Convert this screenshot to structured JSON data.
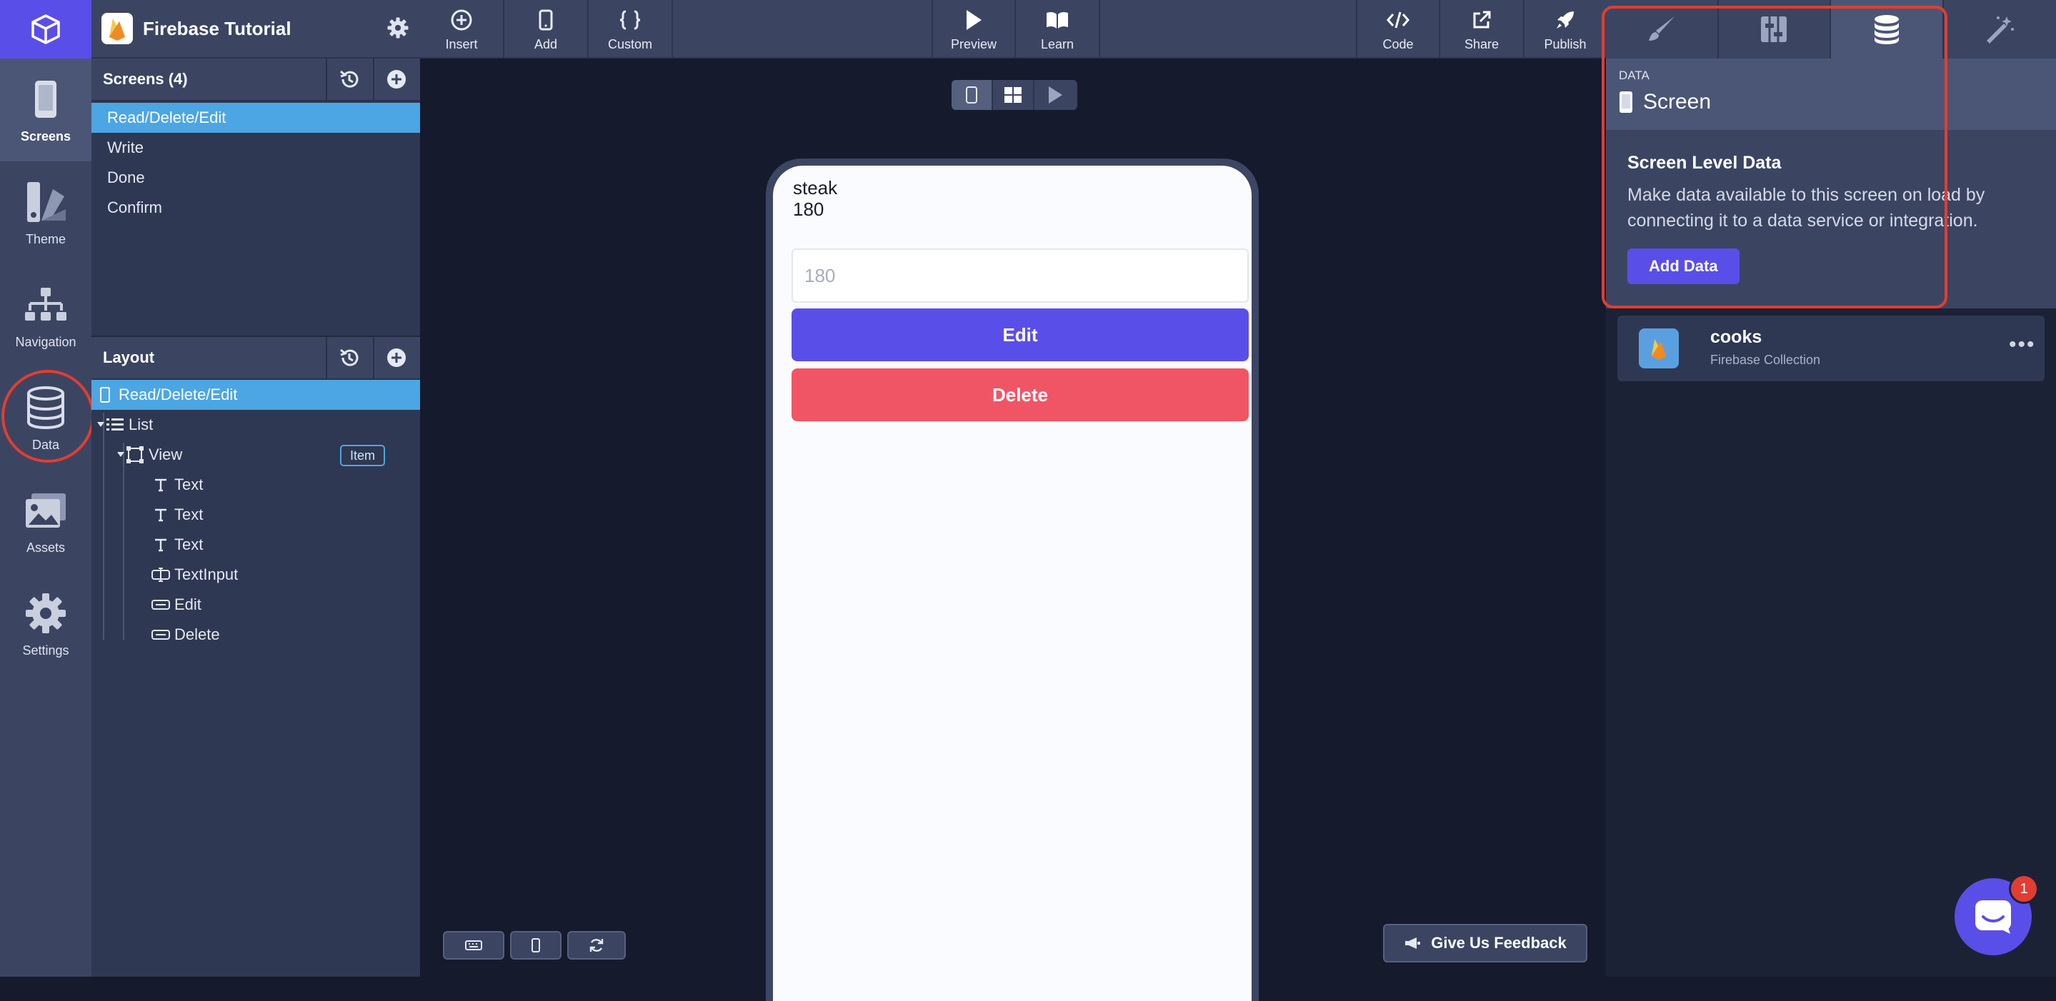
{
  "project": {
    "title": "Firebase Tutorial"
  },
  "rail": {
    "items": [
      {
        "label": "Screens",
        "icon": "phone-icon"
      },
      {
        "label": "Theme",
        "icon": "theme-icon"
      },
      {
        "label": "Navigation",
        "icon": "navigation-icon"
      },
      {
        "label": "Data",
        "icon": "database-icon"
      },
      {
        "label": "Assets",
        "icon": "image-icon"
      },
      {
        "label": "Settings",
        "icon": "gear-icon"
      }
    ]
  },
  "toolbar": {
    "insert": "Insert",
    "add": "Add",
    "custom": "Custom",
    "preview": "Preview",
    "learn": "Learn",
    "code": "Code",
    "share": "Share",
    "publish": "Publish"
  },
  "screens": {
    "title": "Screens (4)",
    "items": [
      "Read/Delete/Edit",
      "Write",
      "Done",
      "Confirm"
    ]
  },
  "layout": {
    "title": "Layout",
    "tree": [
      {
        "label": "Read/Delete/Edit"
      },
      {
        "label": "List"
      },
      {
        "label": "View",
        "badge": "Item"
      },
      {
        "label": "Text"
      },
      {
        "label": "Text"
      },
      {
        "label": "Text"
      },
      {
        "label": "TextInput"
      },
      {
        "label": "Edit"
      },
      {
        "label": "Delete"
      }
    ]
  },
  "phone": {
    "line1": "steak",
    "line2": "180",
    "input_placeholder": "180",
    "edit_label": "Edit",
    "delete_label": "Delete"
  },
  "feedback": {
    "label": "Give Us Feedback"
  },
  "right": {
    "section": "DATA",
    "title": "Screen",
    "sld_title": "Screen Level Data",
    "sld_desc": "Make data available to this screen on load by connecting it to a data service or integration.",
    "add_button": "Add Data",
    "collection": {
      "name": "cooks",
      "type": "Firebase Collection"
    }
  },
  "chat": {
    "badge": "1"
  },
  "colors": {
    "accent": "#5a4ee8",
    "selection": "#4ca6e3",
    "delete": "#f05566",
    "highlight": "#e23d32"
  }
}
